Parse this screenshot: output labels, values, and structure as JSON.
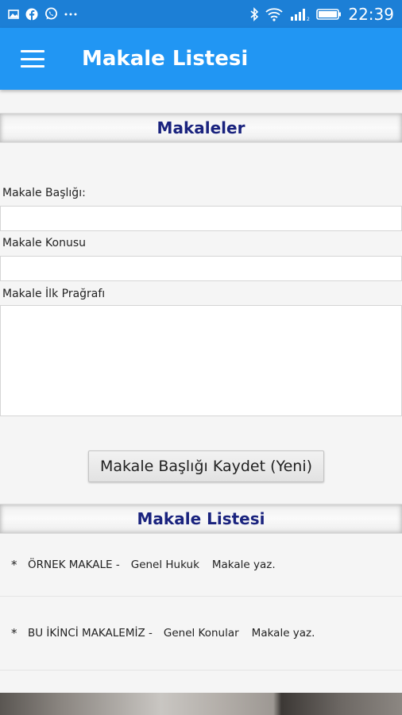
{
  "status_bar": {
    "time": "22:39",
    "left_icons": [
      "image-icon",
      "facebook-icon",
      "whatsapp-icon",
      "more-dots-icon"
    ],
    "right_icons": [
      "bluetooth-icon",
      "wifi-icon",
      "signal-icon",
      "battery-icon"
    ]
  },
  "app_bar": {
    "title": "Makale Listesi"
  },
  "form_section": {
    "header": "Makaleler",
    "title_label": "Makale Başlığı:",
    "title_value": "",
    "topic_label": "Makale Konusu",
    "topic_value": "",
    "paragraph_label": "Makale İlk Prağrafı",
    "paragraph_value": "",
    "save_button": "Makale Başlığı Kaydet (Yeni)"
  },
  "list_section": {
    "header": "Makale Listesi",
    "items": [
      {
        "bullet": "*",
        "title": "ÖRNEK MAKALE -",
        "topic": "Genel Hukuk",
        "action": "Makale yaz."
      },
      {
        "bullet": "*",
        "title": "BU İKİNCİ MAKALEMİZ -",
        "topic": "Genel Konular",
        "action": "Makale yaz."
      }
    ]
  },
  "colors": {
    "status_bar": "#1c7fd6",
    "app_bar": "#2196f3",
    "section_title": "#1a237e"
  }
}
